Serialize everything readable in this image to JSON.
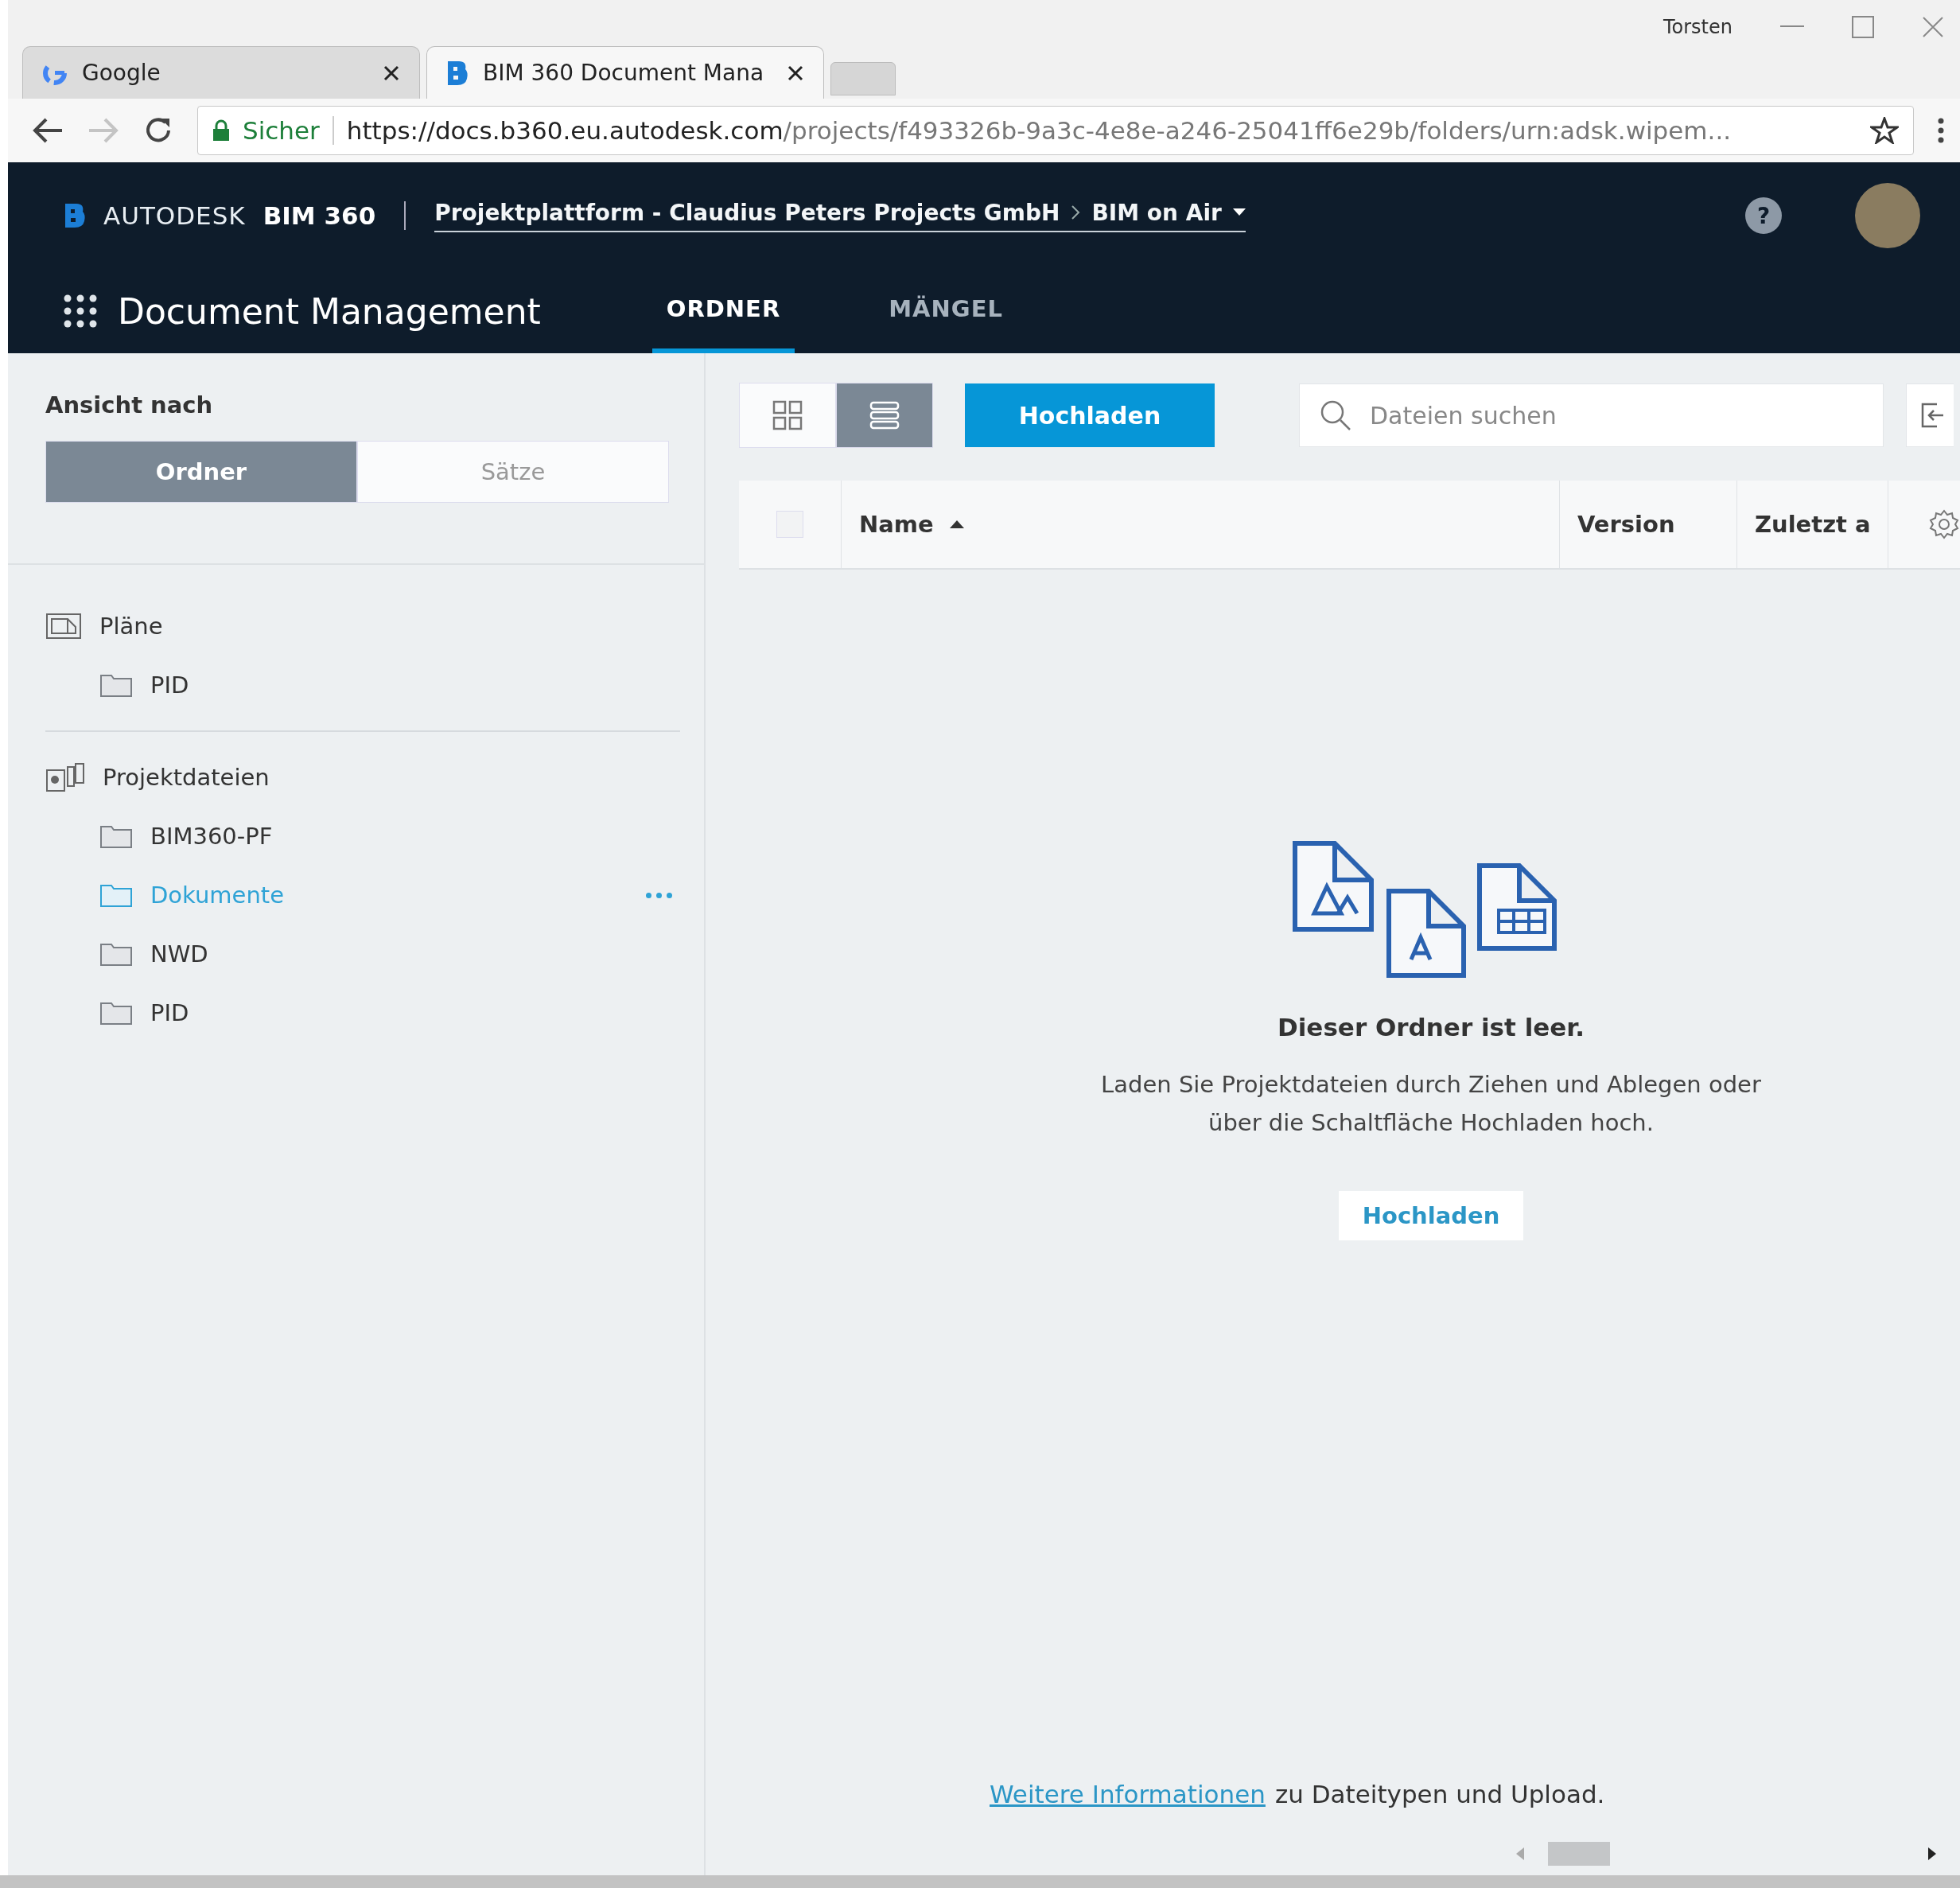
{
  "browser": {
    "profile": "Torsten",
    "tabs": [
      {
        "title": "Google",
        "kind": "google",
        "selected": false
      },
      {
        "title": "BIM 360 Document Mana",
        "kind": "bim",
        "selected": true
      }
    ],
    "security_label": "Sicher",
    "url_host": "https://docs.b360.eu.autodesk.com",
    "url_path": "/projects/f493326b-9a3c-4e8e-a246-25041ff6e29b/folders/urn:adsk.wipem..."
  },
  "header": {
    "brand": "AUTODESK",
    "product": "BIM 360",
    "breadcrumb": [
      "Projektplattform - Claudius Peters Projects GmbH",
      "BIM on Air"
    ],
    "help": "?",
    "app_title": "Document Management",
    "tabs": [
      {
        "label": "ORDNER",
        "selected": true
      },
      {
        "label": "MÄNGEL",
        "selected": false
      }
    ]
  },
  "sidebar": {
    "view_label": "Ansicht nach",
    "view_toggle": [
      {
        "label": "Ordner",
        "selected": true
      },
      {
        "label": "Sätze",
        "selected": false
      }
    ],
    "sections": [
      {
        "title": "Pläne",
        "kind": "plans",
        "children": [
          {
            "name": "PID",
            "selected": false
          }
        ]
      },
      {
        "title": "Projektdateien",
        "kind": "files",
        "children": [
          {
            "name": "BIM360-PF",
            "selected": false
          },
          {
            "name": "Dokumente",
            "selected": true
          },
          {
            "name": "NWD",
            "selected": false
          },
          {
            "name": "PID",
            "selected": false
          }
        ]
      }
    ]
  },
  "toolbar": {
    "view_modes": [
      {
        "kind": "grid",
        "selected": false
      },
      {
        "kind": "list",
        "selected": true
      }
    ],
    "upload_button": "Hochladen",
    "search": {
      "placeholder": "Dateien suchen"
    }
  },
  "table": {
    "select_all": {
      "checked": false
    },
    "columns": [
      {
        "label": "Name",
        "sorted_ascending": true
      },
      {
        "label": "Version"
      },
      {
        "label": "Zuletzt a"
      }
    ]
  },
  "empty_state": {
    "title": "Dieser Ordner ist leer.",
    "message": "Laden Sie Projektdateien durch Ziehen und Ablegen oder über die Schaltfläche Hochladen hoch.",
    "button": "Hochladen"
  },
  "footer": {
    "link": "Weitere Informationen",
    "text": "zu Dateitypen und Upload."
  }
}
